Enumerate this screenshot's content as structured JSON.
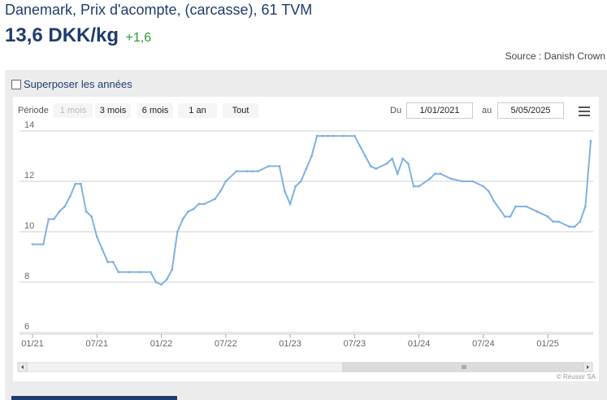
{
  "header": {
    "title": "Danemark, Prix d'acompte, (carcasse), 61 TVM",
    "price": "13,6 DKK/kg",
    "change": "+1,6",
    "source": "Source : Danish Crown"
  },
  "controls": {
    "overlay_label": "Superposer les années",
    "period_label": "Période",
    "periods": [
      "1 mois",
      "3 mois",
      "6 mois",
      "1 an",
      "Tout"
    ],
    "du_label": "Du",
    "au_label": "au",
    "date_from": "1/01/2021",
    "date_to": "5/05/2025"
  },
  "credit": "© Réussir SA",
  "colors": {
    "line": "#7fb2e0",
    "title": "#1f3c6e",
    "positive": "#2e9a2e"
  },
  "chart_data": {
    "type": "line",
    "title": "",
    "xlabel": "",
    "ylabel": "",
    "ylim": [
      6,
      14
    ],
    "yticks": [
      6,
      8,
      10,
      12,
      14
    ],
    "xlim": [
      "2021-01",
      "2025-05"
    ],
    "xticks": [
      "01/21",
      "07/21",
      "01/22",
      "07/22",
      "01/23",
      "07/23",
      "01/24",
      "07/24",
      "01/25"
    ],
    "grid": true,
    "legend": "none",
    "series": [
      {
        "x": [
          "2021-01",
          "2021-02",
          "2021-02",
          "2021-03",
          "2021-03",
          "2021-04",
          "2021-04",
          "2021-05",
          "2021-05",
          "2021-06",
          "2021-06",
          "2021-07",
          "2021-07",
          "2021-08",
          "2021-08",
          "2021-09",
          "2021-10",
          "2021-11",
          "2021-12",
          "2021-12",
          "2022-01",
          "2022-01",
          "2022-02",
          "2022-02",
          "2022-03",
          "2022-03",
          "2022-04",
          "2022-04",
          "2022-05",
          "2022-06",
          "2022-06",
          "2022-07",
          "2022-08",
          "2022-09",
          "2022-09",
          "2022-10",
          "2022-11",
          "2022-12",
          "2022-12",
          "2023-01",
          "2023-01",
          "2023-02",
          "2023-02",
          "2023-03",
          "2023-03",
          "2023-04",
          "2023-04",
          "2023-05",
          "2023-06",
          "2023-07",
          "2023-07",
          "2023-08",
          "2023-08",
          "2023-09",
          "2023-10",
          "2023-10",
          "2023-11",
          "2023-11",
          "2023-12",
          "2023-12",
          "2024-01",
          "2024-02",
          "2024-02",
          "2024-03",
          "2024-04",
          "2024-05",
          "2024-06",
          "2024-07",
          "2024-07",
          "2024-08",
          "2024-09",
          "2024-09",
          "2024-10",
          "2024-11",
          "2024-12",
          "2025-01",
          "2025-01",
          "2025-02",
          "2025-03",
          "2025-03",
          "2025-04",
          "2025-04",
          "2025-05"
        ],
        "values": [
          9.5,
          9.5,
          10.5,
          10.5,
          10.8,
          11.0,
          11.4,
          11.9,
          11.9,
          10.8,
          10.6,
          9.8,
          9.3,
          8.8,
          8.8,
          8.4,
          8.4,
          8.4,
          8.4,
          8.0,
          7.9,
          8.1,
          8.5,
          10.0,
          10.5,
          10.8,
          10.9,
          11.1,
          11.1,
          11.3,
          11.6,
          12.0,
          12.4,
          12.4,
          12.4,
          12.4,
          12.6,
          12.6,
          11.6,
          11.1,
          11.8,
          12.0,
          12.5,
          13.0,
          13.8,
          13.8,
          13.8,
          13.8,
          13.8,
          13.8,
          13.4,
          13.0,
          12.6,
          12.5,
          12.7,
          12.9,
          12.3,
          12.9,
          12.7,
          11.8,
          11.8,
          12.1,
          12.3,
          12.3,
          12.1,
          12.0,
          12.0,
          11.8,
          11.6,
          11.2,
          10.6,
          10.6,
          11.0,
          11.0,
          10.8,
          10.6,
          10.4,
          10.4,
          10.2,
          10.2,
          10.4,
          11.0,
          13.6
        ]
      }
    ]
  }
}
